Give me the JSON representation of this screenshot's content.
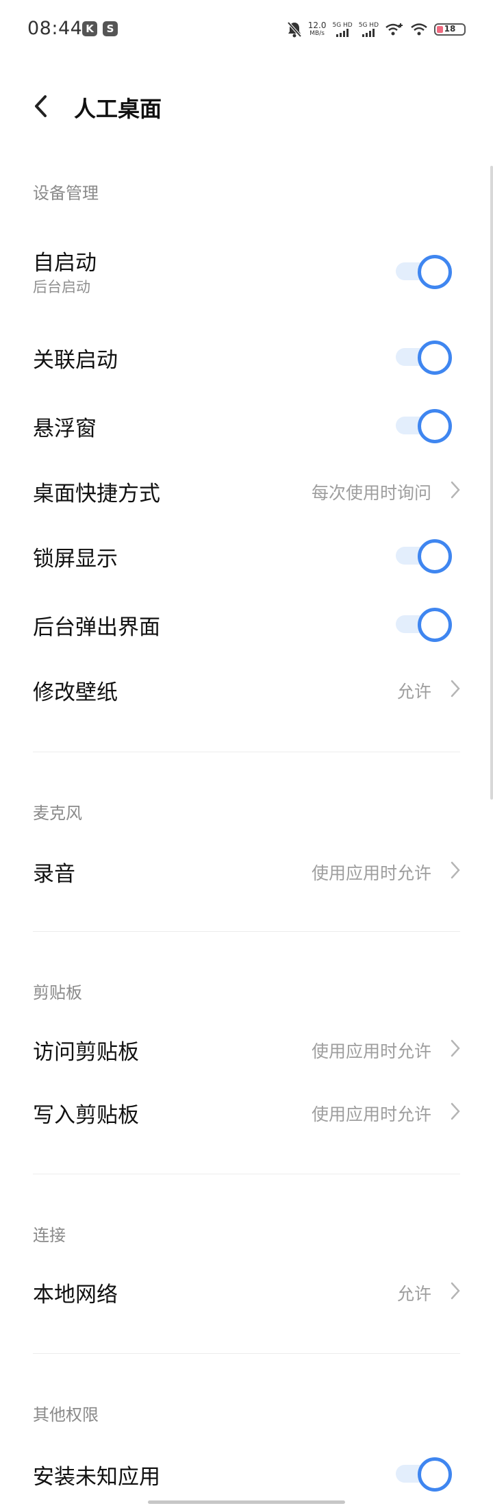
{
  "status_bar": {
    "time": "08:44",
    "app_icons": [
      "K",
      "S"
    ],
    "net_speed_value": "12.0",
    "net_speed_unit": "MB/s",
    "sim1_label": "5G HD",
    "sim2_label": "5G HD",
    "battery_level": "18"
  },
  "header": {
    "title": "人工桌面"
  },
  "sections": {
    "device": {
      "label": "设备管理",
      "items": [
        {
          "title": "自启动",
          "subtitle": "后台启动",
          "toggle_on": true
        },
        {
          "title": "关联启动",
          "toggle_on": true
        },
        {
          "title": "悬浮窗",
          "toggle_on": true
        },
        {
          "title": "桌面快捷方式",
          "value": "每次使用时询问"
        },
        {
          "title": "锁屏显示",
          "toggle_on": true
        },
        {
          "title": "后台弹出界面",
          "toggle_on": true
        },
        {
          "title": "修改壁纸",
          "value": "允许"
        }
      ]
    },
    "mic": {
      "label": "麦克风",
      "items": [
        {
          "title": "录音",
          "value": "使用应用时允许"
        }
      ]
    },
    "clipboard": {
      "label": "剪贴板",
      "items": [
        {
          "title": "访问剪贴板",
          "value": "使用应用时允许"
        },
        {
          "title": "写入剪贴板",
          "value": "使用应用时允许"
        }
      ]
    },
    "connect": {
      "label": "连接",
      "items": [
        {
          "title": "本地网络",
          "value": "允许"
        }
      ]
    },
    "other": {
      "label": "其他权限",
      "items": [
        {
          "title": "安装未知应用",
          "toggle_on": true
        }
      ]
    }
  },
  "colors": {
    "accent": "#3f86f0",
    "track": "#e3eefc"
  },
  "icons": {
    "back": "chevron-left-icon",
    "disclosure": "chevron-right-icon"
  }
}
